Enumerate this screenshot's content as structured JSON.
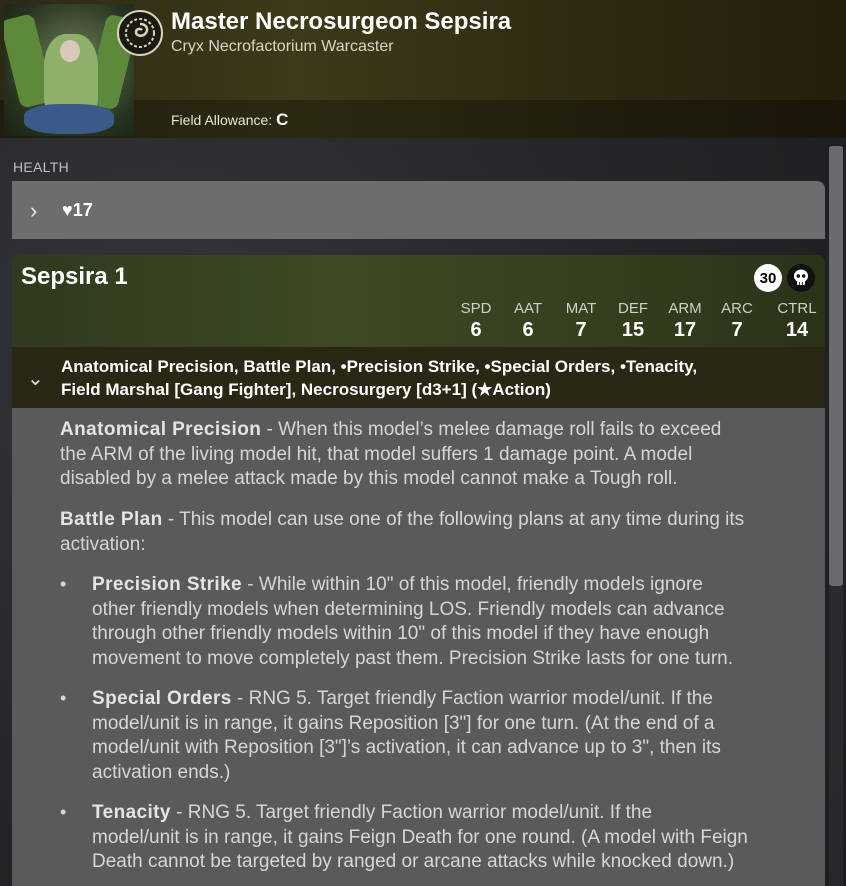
{
  "header": {
    "title": "Master Necrosurgeon Sepsira",
    "subtitle": "Cryx Necrofactorium Warcaster",
    "field_allowance_label": "Field Allowance:",
    "field_allowance_value": "C"
  },
  "health": {
    "section_label": "HEALTH",
    "value": "17"
  },
  "card": {
    "name": "Sepsira 1",
    "points": "30",
    "stats": [
      {
        "label": "SPD",
        "value": "6"
      },
      {
        "label": "AAT",
        "value": "6"
      },
      {
        "label": "MAT",
        "value": "7"
      },
      {
        "label": "DEF",
        "value": "15"
      },
      {
        "label": "ARM",
        "value": "17"
      },
      {
        "label": "ARC",
        "value": "7"
      },
      {
        "label": "CTRL",
        "value": "14"
      }
    ],
    "abilities_summary_line1": "Anatomical Precision, Battle Plan, •Precision Strike, •Special Orders, •Tenacity,",
    "abilities_summary_line2": "Field Marshal [Gang Fighter], Necrosurgery [d3+1] (★Action)"
  },
  "abilities": [
    {
      "name": "Anatomical Precision",
      "lines": [
        " - When this model’s melee damage roll fails to exceed",
        "the ARM of the living model hit, that model suffers 1 damage point. A model",
        "disabled by a melee attack made by this model cannot make a Tough roll."
      ]
    },
    {
      "name": "Battle Plan",
      "lines": [
        " - This model can use one of the following plans at any time during its",
        "activation:"
      ]
    },
    {
      "name": "Precision Strike",
      "lines": [
        " - While within 10\" of this model, friendly models ignore",
        "other friendly models when determining LOS. Friendly models can advance",
        "through other friendly models within 10\" of this model if they have enough",
        "movement to move completely past them. Precision Strike lasts for one turn."
      ]
    },
    {
      "name": "Special Orders",
      "lines": [
        " - RNG 5. Target friendly Faction warrior model/unit. If the",
        "model/unit is in range, it gains Reposition [3\"] for one turn. (At the end of a",
        "model/unit with Reposition [3\"]’s activation, it can advance up to 3\", then its",
        "activation ends.)"
      ]
    },
    {
      "name": "Tenacity",
      "lines": [
        " - RNG 5. Target friendly Faction warrior model/unit. If the",
        "model/unit is in range, it gains Feign Death for one round. (A model with Feign",
        "Death cannot be targeted by ranged or arcane attacks while knocked down.)"
      ]
    }
  ],
  "bullet_char": "•",
  "icons": {
    "portrait": "model-portrait",
    "faction": "cryx-faction-icon",
    "health_expand": "chevron-right-icon",
    "heart": "heart-icon",
    "abilities_collapse": "chevron-down-icon",
    "skull": "skull-icon"
  }
}
